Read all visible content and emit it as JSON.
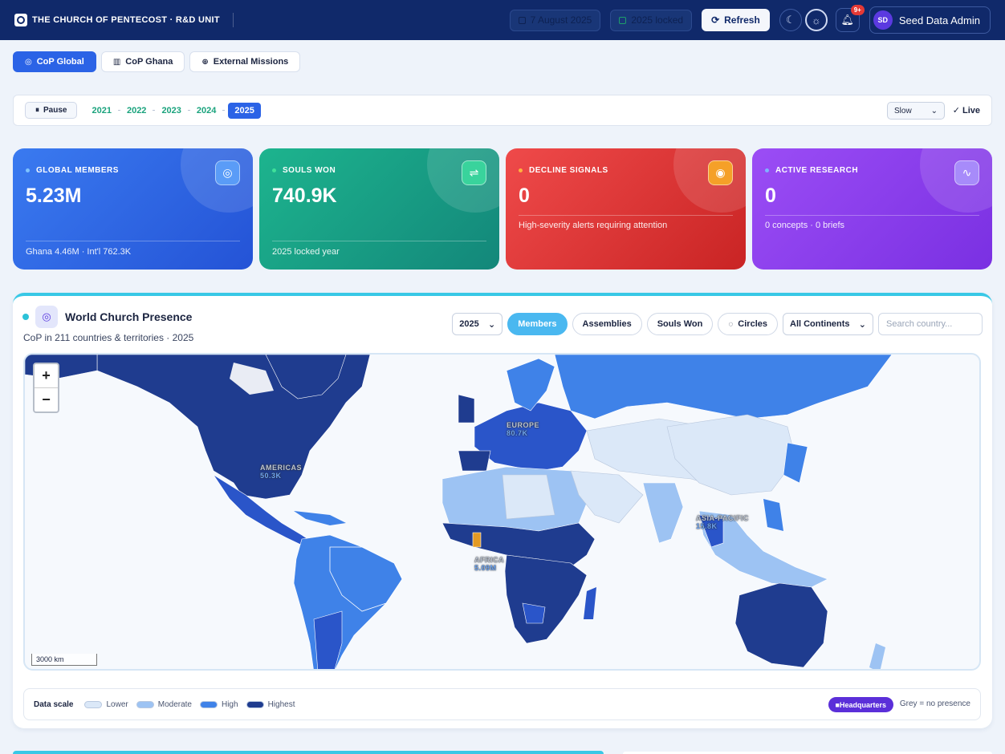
{
  "header": {
    "brand": "THE CHURCH OF PENTECOST · R&D UNIT",
    "date": "7 August 2025",
    "locked": "2025 locked",
    "refresh_label": "Refresh",
    "notif_count": "9+",
    "user_initials": "SD",
    "user_name": "Seed Data Admin"
  },
  "tabs": [
    {
      "label": "CoP Global",
      "icon": "globe-icon",
      "active": true
    },
    {
      "label": "CoP Ghana",
      "icon": "map-icon",
      "active": false
    },
    {
      "label": "External Missions",
      "icon": "world-icon",
      "active": false
    }
  ],
  "timeline": {
    "pause_label": "Pause",
    "years": [
      "2021",
      "2022",
      "2023",
      "2024",
      "2025"
    ],
    "active_year": "2025",
    "speed": "Slow",
    "live_label": "Live"
  },
  "kpis": [
    {
      "label": "GLOBAL MEMBERS",
      "value": "5.23M",
      "sub": "Ghana 4.46M · Int'l 762.3K",
      "icon": "globe-icon",
      "color": "#2b63e6"
    },
    {
      "label": "SOULS WON",
      "value": "740.9K",
      "sub": "2025 locked year",
      "icon": "route-icon",
      "color": "#17a082"
    },
    {
      "label": "DECLINE SIGNALS",
      "value": "0",
      "sub": "High-severity alerts requiring attention",
      "icon": "target-icon",
      "color": "#e03a3a"
    },
    {
      "label": "ACTIVE RESEARCH",
      "value": "0",
      "sub": "0 concepts · 0 briefs",
      "icon": "pulse-icon",
      "color": "#8a3ef0"
    }
  ],
  "map_card": {
    "title": "World Church Presence",
    "subtitle": "CoP in 211 countries & territories · 2025",
    "year_select": "2025",
    "metrics": [
      "Members",
      "Assemblies",
      "Souls Won",
      "Circles"
    ],
    "active_metric": "Members",
    "continent_select": "All Continents",
    "search_placeholder": "Search country...",
    "scale_label": "3000 km",
    "regions": [
      {
        "name": "AMERICAS",
        "value": "50.3K"
      },
      {
        "name": "EUROPE",
        "value": "80.7K"
      },
      {
        "name": "AFRICA",
        "value": "5.09M"
      },
      {
        "name": "ASIA-PACIFIC",
        "value": "15.8K"
      }
    ],
    "legend": {
      "title": "Data scale",
      "items": [
        {
          "label": "Lower",
          "color": "#dbe8f8"
        },
        {
          "label": "Moderate",
          "color": "#9dc3f3"
        },
        {
          "label": "High",
          "color": "#3f82e8"
        },
        {
          "label": "Highest",
          "color": "#1f3c8f"
        }
      ],
      "hq_label": "Headquarters",
      "grey_note": "Grey = no presence"
    }
  }
}
